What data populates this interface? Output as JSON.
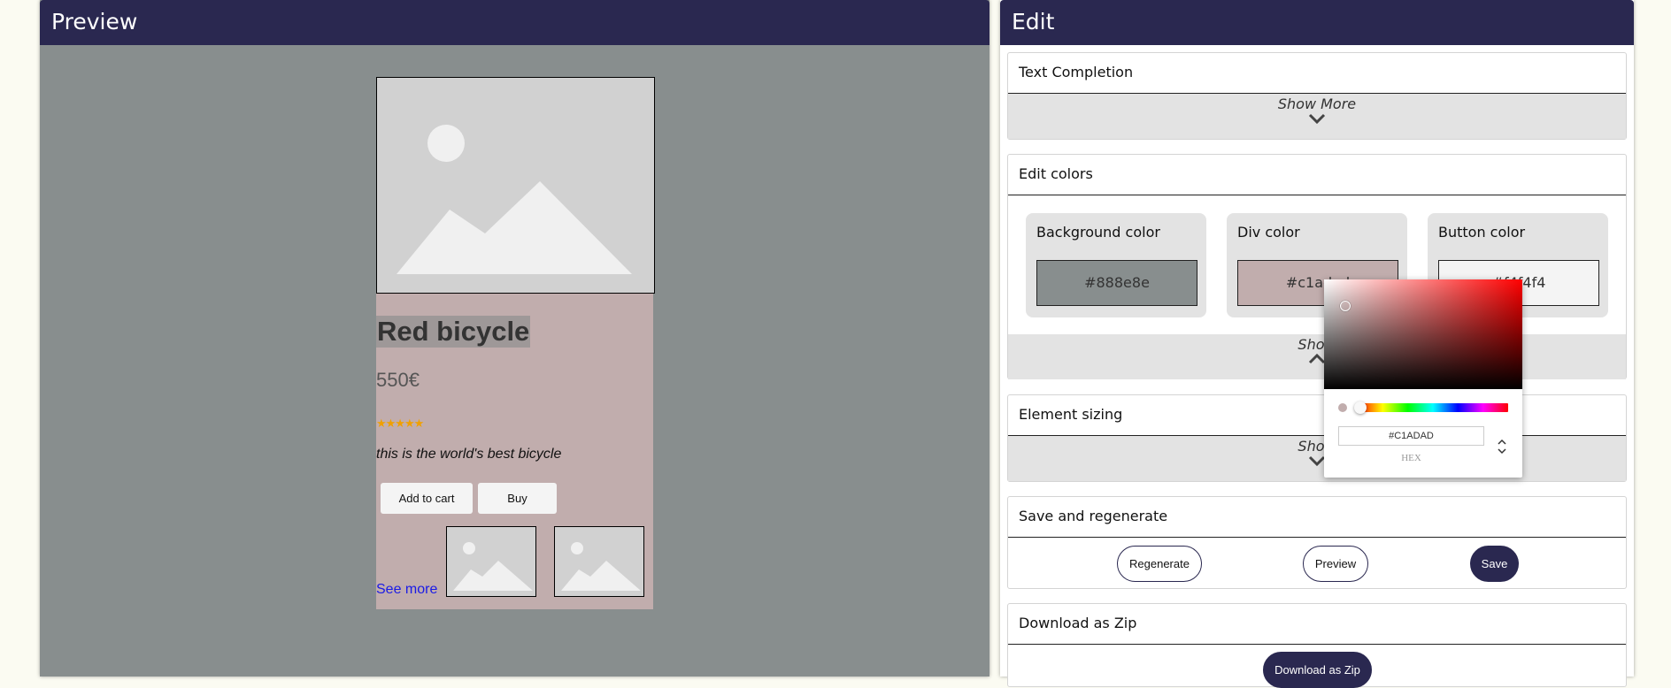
{
  "preview": {
    "header_title": "Preview",
    "product": {
      "title": "Red bicycle",
      "price": "550€",
      "stars": "★★★★★",
      "description": "this is the world's best bicycle",
      "add_to_cart_label": "Add to cart",
      "buy_label": "Buy",
      "see_more_label": "See more"
    }
  },
  "edit": {
    "header_title": "Edit",
    "sections": {
      "text_completion": {
        "title": "Text Completion",
        "show_more_label": "Show More"
      },
      "edit_colors": {
        "title": "Edit colors",
        "show_label": "Show",
        "background": {
          "label": "Background color",
          "value": "#888e8e"
        },
        "div": {
          "label": "Div color",
          "value": "#c1adad"
        },
        "button": {
          "label": "Button color",
          "value": "#f4f4f4"
        }
      },
      "element_sizing": {
        "title": "Element sizing",
        "show_label": "Show"
      },
      "save_regenerate": {
        "title": "Save and regenerate",
        "regenerate_label": "Regenerate",
        "preview_label": "Preview",
        "save_label": "Save"
      },
      "download_zip": {
        "title": "Download as Zip",
        "download_label": "Download as Zip"
      }
    }
  },
  "color_picker": {
    "hex_value": "#C1ADAD",
    "mode_label": "HEX"
  },
  "colors": {
    "header": "#2a2850",
    "preview_background": "#888e8e",
    "card": "#c1adad",
    "button": "#f4f4f4",
    "panel_bar": "#e3e3e3"
  }
}
